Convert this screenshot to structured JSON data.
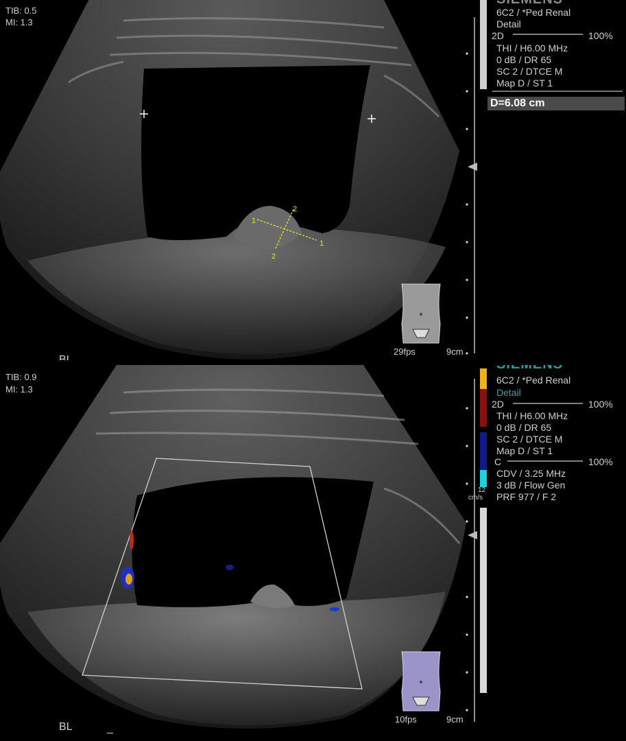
{
  "top": {
    "overlay_left": [
      "TIB: 0.5",
      "MI:  1.3"
    ],
    "brand": "SIEMENS",
    "settings": [
      "6C2 / *Ped Renal",
      "Detail",
      "2D",
      "100%",
      "THI / H6.00 MHz",
      "0 dB / DR 65",
      "SC 2 / DTCE M",
      "Map D / ST 1"
    ],
    "measurement": "D=6.08 cm",
    "caliper_labels": [
      "1",
      "2",
      "2",
      "1"
    ],
    "frame_rate": "29fps",
    "depth": "9cm",
    "organ_label": "BL",
    "underscore": "_"
  },
  "bottom": {
    "overlay_left": [
      "TIB: 0.9",
      "MI:  1.3"
    ],
    "brand": "SIEMENS",
    "settings": [
      "6C2 / *Ped Renal",
      "Detail",
      "2D",
      "100%",
      "THI / H6.00 MHz",
      "0 dB / DR 65",
      "SC 2 / DTCE M",
      "Map D / ST 1",
      "C",
      "100%",
      "CDV / 3.25 MHz",
      "3 dB / Flow Gen",
      "PRF 977 / F 2"
    ],
    "colorbar_value": "12",
    "colorbar_unit": "cm/s",
    "frame_rate": "10fps",
    "depth": "9cm",
    "organ_label": "BL",
    "underscore": "_"
  },
  "colors": {
    "measurement_yellow": "#e6e62a",
    "doppler_red": "#d0301a",
    "doppler_blue": "#2030c0",
    "bodymark_top": "#9a9a9a",
    "bodymark_bottom": "#9a94c8"
  }
}
